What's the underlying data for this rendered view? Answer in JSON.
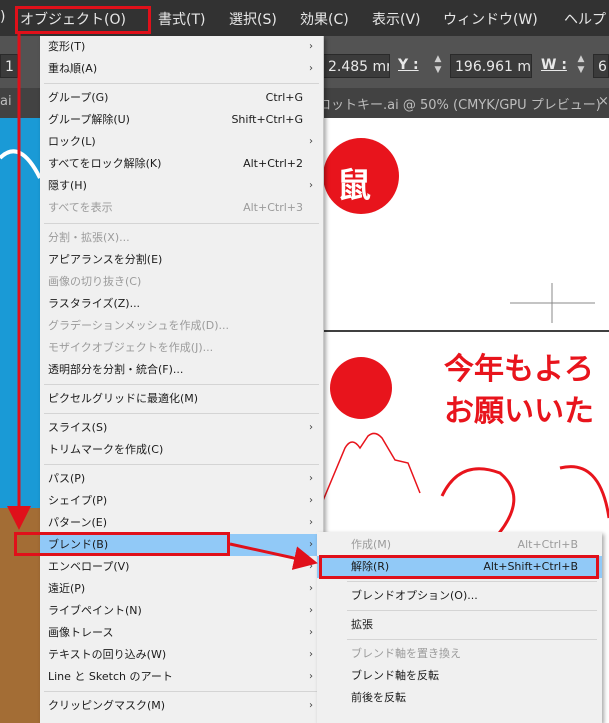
{
  "menubar": {
    "items": [
      {
        "label": ")"
      },
      {
        "label": "オブジェクト(O)"
      },
      {
        "label": "書式(T)"
      },
      {
        "label": "選択(S)"
      },
      {
        "label": "効果(C)"
      },
      {
        "label": "表示(V)"
      },
      {
        "label": "ウィンドウ(W)"
      },
      {
        "label": "ヘルプ"
      }
    ]
  },
  "controlbar": {
    "left_value": "1",
    "x_value": "2.485 mr",
    "y_label": "Y :",
    "y_value": "196.961 m",
    "w_label": "W :",
    "w_value": "6"
  },
  "tabbar": {
    "left_tab": "ai",
    "doc_tab": "ロットキー.ai @ 50% (CMYK/GPU プレビュー)",
    "close_icon": "×"
  },
  "artwork": {
    "kanji": "鼠",
    "greeting_line1": "今年もよろ",
    "greeting_line2": "お願いいた",
    "colors": {
      "red": "#e8141c",
      "blue": "#1a9ad6",
      "brown": "#a36d35"
    }
  },
  "menu": {
    "items": [
      {
        "label": "変形(T)",
        "shortcut": "",
        "submenu": true,
        "disabled": false
      },
      {
        "label": "重ね順(A)",
        "shortcut": "",
        "submenu": true,
        "disabled": false
      },
      {
        "label": "グループ(G)",
        "shortcut": "Ctrl+G",
        "submenu": false,
        "disabled": false
      },
      {
        "label": "グループ解除(U)",
        "shortcut": "Shift+Ctrl+G",
        "submenu": false,
        "disabled": false
      },
      {
        "label": "ロック(L)",
        "shortcut": "",
        "submenu": true,
        "disabled": false
      },
      {
        "label": "すべてをロック解除(K)",
        "shortcut": "Alt+Ctrl+2",
        "submenu": false,
        "disabled": false
      },
      {
        "label": "隠す(H)",
        "shortcut": "",
        "submenu": true,
        "disabled": false
      },
      {
        "label": "すべてを表示",
        "shortcut": "Alt+Ctrl+3",
        "submenu": false,
        "disabled": true
      },
      {
        "label": "分割・拡張(X)...",
        "shortcut": "",
        "submenu": false,
        "disabled": true
      },
      {
        "label": "アピアランスを分割(E)",
        "shortcut": "",
        "submenu": false,
        "disabled": false
      },
      {
        "label": "画像の切り抜き(C)",
        "shortcut": "",
        "submenu": false,
        "disabled": true
      },
      {
        "label": "ラスタライズ(Z)...",
        "shortcut": "",
        "submenu": false,
        "disabled": false
      },
      {
        "label": "グラデーションメッシュを作成(D)...",
        "shortcut": "",
        "submenu": false,
        "disabled": true
      },
      {
        "label": "モザイクオブジェクトを作成(J)...",
        "shortcut": "",
        "submenu": false,
        "disabled": true
      },
      {
        "label": "透明部分を分割・統合(F)...",
        "shortcut": "",
        "submenu": false,
        "disabled": false
      },
      {
        "label": "ピクセルグリッドに最適化(M)",
        "shortcut": "",
        "submenu": false,
        "disabled": false
      },
      {
        "label": "スライス(S)",
        "shortcut": "",
        "submenu": true,
        "disabled": false
      },
      {
        "label": "トリムマークを作成(C)",
        "shortcut": "",
        "submenu": false,
        "disabled": false
      },
      {
        "label": "パス(P)",
        "shortcut": "",
        "submenu": true,
        "disabled": false
      },
      {
        "label": "シェイプ(P)",
        "shortcut": "",
        "submenu": true,
        "disabled": false
      },
      {
        "label": "パターン(E)",
        "shortcut": "",
        "submenu": true,
        "disabled": false
      },
      {
        "label": "ブレンド(B)",
        "shortcut": "",
        "submenu": true,
        "disabled": false,
        "highlighted": true
      },
      {
        "label": "エンベロープ(V)",
        "shortcut": "",
        "submenu": true,
        "disabled": false
      },
      {
        "label": "遠近(P)",
        "shortcut": "",
        "submenu": true,
        "disabled": false
      },
      {
        "label": "ライブペイント(N)",
        "shortcut": "",
        "submenu": true,
        "disabled": false
      },
      {
        "label": "画像トレース",
        "shortcut": "",
        "submenu": true,
        "disabled": false
      },
      {
        "label": "テキストの回り込み(W)",
        "shortcut": "",
        "submenu": true,
        "disabled": false
      },
      {
        "label": "Line と Sketch のアート",
        "shortcut": "",
        "submenu": true,
        "disabled": false
      },
      {
        "label": "クリッピングマスク(M)",
        "shortcut": "",
        "submenu": true,
        "disabled": false
      }
    ]
  },
  "submenu": {
    "items": [
      {
        "label": "作成(M)",
        "shortcut": "Alt+Ctrl+B",
        "disabled": true
      },
      {
        "label": "解除(R)",
        "shortcut": "Alt+Shift+Ctrl+B",
        "disabled": false,
        "highlighted": true
      },
      {
        "label": "ブレンドオプション(O)...",
        "shortcut": "",
        "disabled": false
      },
      {
        "label": "拡張",
        "shortcut": "",
        "disabled": false
      },
      {
        "label": "ブレンド軸を置き換え",
        "shortcut": "",
        "disabled": true
      },
      {
        "label": "ブレンド軸を反転",
        "shortcut": "",
        "disabled": false
      },
      {
        "label": "前後を反転",
        "shortcut": "",
        "disabled": false
      }
    ]
  },
  "icons": {
    "submenu_arrow": "chevron-right-icon",
    "spinner": "up-down-spinner-icon"
  },
  "accent": {
    "highlight": "#91c9f7",
    "annotation": "#e0101a"
  }
}
